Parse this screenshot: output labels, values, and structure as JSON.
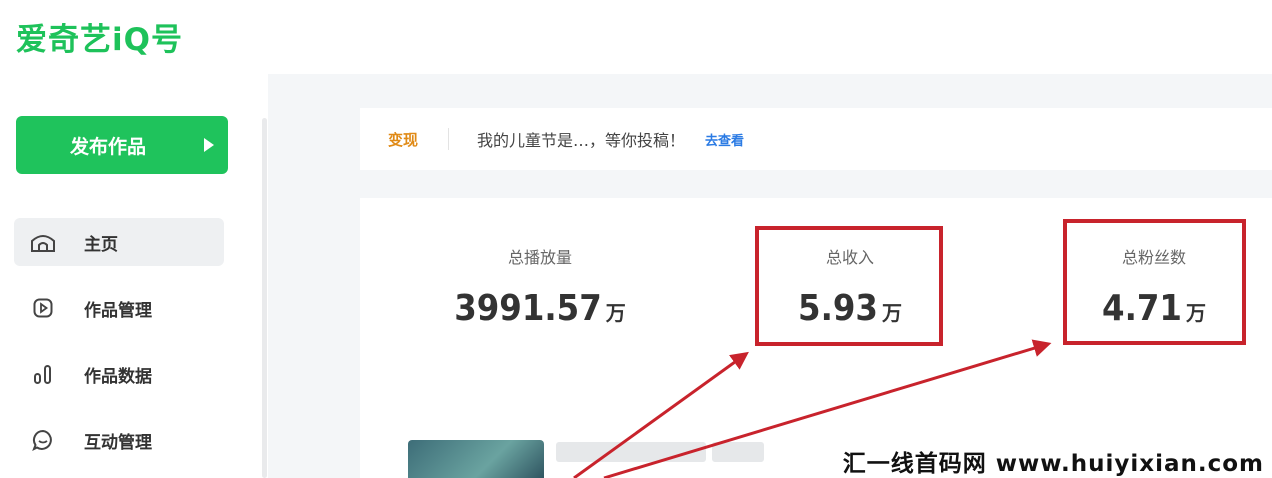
{
  "logo": {
    "text": "爱奇艺iQ号"
  },
  "sidebar": {
    "publish_button": "发布作品",
    "items": [
      {
        "label": "主页",
        "icon": "home-icon",
        "active": true
      },
      {
        "label": "作品管理",
        "icon": "play-square-icon",
        "active": false
      },
      {
        "label": "作品数据",
        "icon": "bar-chart-icon",
        "active": false
      },
      {
        "label": "互动管理",
        "icon": "chat-bubble-icon",
        "active": false
      }
    ]
  },
  "notice": {
    "tag": "变现",
    "message": "我的儿童节是…，等你投稿！",
    "link": "去查看"
  },
  "stats": [
    {
      "label": "总播放量",
      "value": "3991.57",
      "unit": "万",
      "highlighted": false
    },
    {
      "label": "总收入",
      "value": "5.93",
      "unit": "万",
      "highlighted": true
    },
    {
      "label": "总粉丝数",
      "value": "4.71",
      "unit": "万",
      "highlighted": true
    }
  ],
  "annotation_color": "#c8232c",
  "accent_color": "#1fc35c",
  "watermark": "汇一线首码网 www.huiyixian.com"
}
